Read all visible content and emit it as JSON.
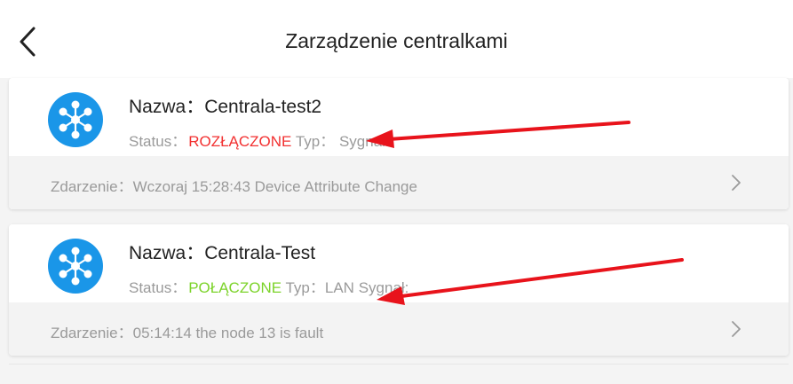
{
  "header": {
    "title": "Zarządzenie centralkami",
    "back_icon": "chevron-left-icon"
  },
  "devices": [
    {
      "name_label": "Nazwa：",
      "name": "Centrala-test2",
      "status_label": "Status：",
      "status": "ROZŁĄCZONE",
      "status_color": "#f23030",
      "type_label": "Typ：",
      "type": "",
      "signal_label": "Sygnał:",
      "event_label": "Zdarzenie：",
      "event": "Wczoraj 15:28:43 Device Attribute Change"
    },
    {
      "name_label": "Nazwa：",
      "name": "Centrala-Test",
      "status_label": "Status：",
      "status": "POŁĄCZONE",
      "status_color": "#7cd32a",
      "type_label": "Typ：",
      "type": "LAN",
      "signal_label": "Sygnał:",
      "event_label": "Zdarzenie：",
      "event": "05:14:14 the node 13 is fault"
    }
  ],
  "colors": {
    "icon_blue": "#1a96e8",
    "annotation_arrow": "#e8131b"
  }
}
